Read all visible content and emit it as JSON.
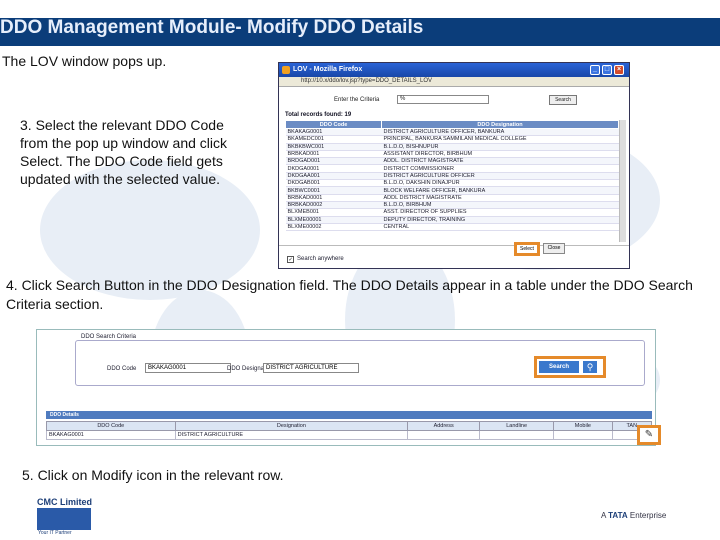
{
  "slide": {
    "title": "DDO Management Module- Modify DDO Details",
    "intro": "The LOV window pops up.",
    "step3": "3. Select the relevant DDO Code from the pop up window and click Select. The DDO Code field gets updated with the selected value.",
    "step4": "4. Click Search Button in the DDO Designation field. The DDO Details appear in a table under the DDO Search Criteria section.",
    "step5": "5. Click on Modify icon in the relevant row."
  },
  "lov_window": {
    "title": "LOV - Mozilla Firefox",
    "address": "http://10.x/ddo/lov.jsp?type=DDO_DETAILS_LOV",
    "enter_criteria_label": "Enter the Criteria",
    "criteria_value": "%",
    "search_button": "Search",
    "records_found": "Total records found: 19",
    "columns": [
      "DDO Code",
      "DDO Designation"
    ],
    "rows": [
      [
        "BKAKAG0001",
        "DISTRICT AGRICULTURE OFFICER, BANKURA"
      ],
      [
        "BKAMEDC001",
        "PRINCIPAL, BANKURA SAMMILANI MEDICAL COLLEGE"
      ],
      [
        "BKBKBWC001",
        "B.L.D.O, BISHNUPUR"
      ],
      [
        "BRBKAD001",
        "ASSISTANT DIRECTOR, BIRBHUM"
      ],
      [
        "BRDGAD001",
        "ADDL. DISTRICT MAGISTRATE"
      ],
      [
        "DKDGA0001",
        "DISTRICT COMMISSIONER"
      ],
      [
        "DKDGAA001",
        "DISTRICT AGRICULTURE OFFICER"
      ],
      [
        "DKDGAB001",
        "B.L.D.O, DAKSHIN DINAJPUR"
      ],
      [
        "BKBWC0001",
        "BLOCK WELFARE OFFICER, BANKURA"
      ],
      [
        "BRBKAD0001",
        "ADDL DISTRICT MAGISTRATE"
      ],
      [
        "BRBKAD0002",
        "B.L.D.O, BIRBHUM"
      ],
      [
        "BLXMEB001",
        "ASST. DIRECTOR OF SUPPLIES"
      ],
      [
        "BLXME00001",
        "DEPUTY DIRECTOR, TRAINING"
      ],
      [
        "BLXME00002",
        "CENTRAL"
      ]
    ],
    "search_anywhere_label": "Search anywhere",
    "select_button": "Select",
    "close_button": "Close"
  },
  "search_panel": {
    "legend": "DDO Search Criteria",
    "ddo_code_label": "DDO Code",
    "ddo_code_value": "BKAKAG0001",
    "designation_label": "DDO Designation",
    "designation_value": "DISTRICT AGRICULTURE",
    "search_button": "Search",
    "details_title": "DDO Details",
    "columns": [
      "DDO Code",
      "Designation",
      "Address",
      "Landline",
      "Mobile",
      "TAN"
    ],
    "row": [
      "BKAKAG0001",
      "DISTRICT AGRICULTURE",
      "",
      "",
      "",
      ""
    ]
  },
  "footer": {
    "cmc_name": "CMC Limited",
    "cmc_tagline": "Your IT Partner",
    "tata_prefix": "A",
    "tata_brand": "TATA",
    "tata_suffix": "Enterprise"
  },
  "colors": {
    "title_bg": "#0b3d7a",
    "highlight": "#e58a2a",
    "table_header": "#6b8cc4"
  }
}
